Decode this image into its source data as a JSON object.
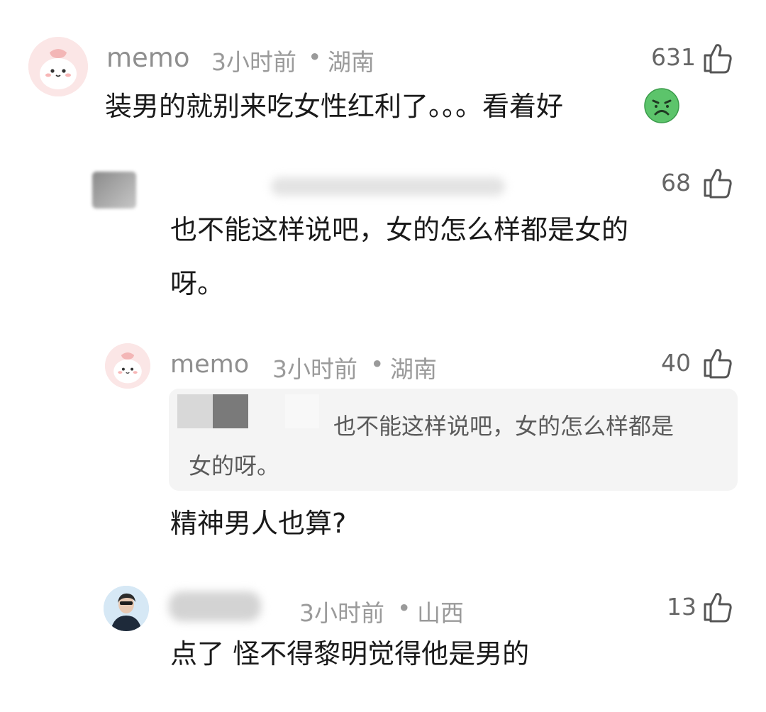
{
  "comments": [
    {
      "name": "memo",
      "time": "3小时前",
      "location": "湖南",
      "likes": "631",
      "text": "装男的就别来吃女性红利了。。。看着好",
      "emoji_icon": "nauseated-face-icon"
    },
    {
      "likes": "68",
      "text_line1": "也不能这样说吧，女的怎么样都是女的",
      "text_line2": "呀。"
    },
    {
      "name": "memo",
      "time": "3小时前",
      "location": "湖南",
      "likes": "40",
      "quote_line1": "也不能这样说吧，女的怎么样都是",
      "quote_line2": "女的呀。",
      "text": "精神男人也算?"
    },
    {
      "time": "3小时前",
      "location": "山西",
      "likes": "13",
      "text": "点了 怪不得黎明觉得他是男的"
    }
  ],
  "separator": "•",
  "colors": {
    "meta": "#9a9a9a",
    "text": "#1a1a1a",
    "quote_bg": "#f4f4f4",
    "emoji_green": "#5cc46b"
  }
}
